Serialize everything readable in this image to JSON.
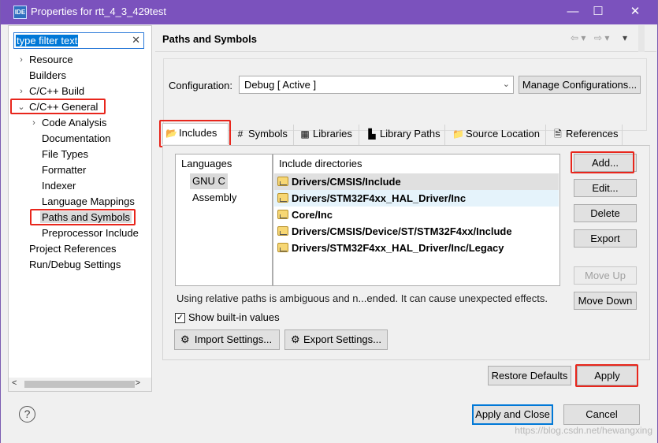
{
  "window": {
    "app_badge": "IDE",
    "title": "Properties for rtt_4_3_429test",
    "minimize_glyph": "—",
    "maximize_glyph": "☐",
    "close_glyph": "✕"
  },
  "left": {
    "filter_text": "type filter text",
    "filter_clear_glyph": "✕",
    "tree": [
      {
        "label": "Resource",
        "arrow": "›"
      },
      {
        "label": "Builders"
      },
      {
        "label": "C/C++ Build",
        "arrow": "›"
      },
      {
        "label": "C/C++ General",
        "arrow": "⌄"
      },
      {
        "label": "Code Analysis",
        "arrow": "›"
      },
      {
        "label": "Documentation"
      },
      {
        "label": "File Types"
      },
      {
        "label": "Formatter"
      },
      {
        "label": "Indexer"
      },
      {
        "label": "Language Mappings"
      },
      {
        "label": "Paths and Symbols"
      },
      {
        "label": "Preprocessor Include"
      },
      {
        "label": "Project References"
      },
      {
        "label": "Run/Debug Settings"
      }
    ],
    "scroll_left": "<",
    "scroll_right": ">"
  },
  "header": {
    "title": "Paths and Symbols",
    "nav_back": "⇦ ▾",
    "nav_forward": "⇨ ▾",
    "menu": "▾"
  },
  "config": {
    "label": "Configuration:",
    "value": "Debug  [ Active ]",
    "manage_button": "Manage Configurations..."
  },
  "tabs": [
    {
      "label": "Includes",
      "icon": "includes-icon",
      "glyph": "📂"
    },
    {
      "label": "Symbols",
      "icon": "hash-icon",
      "glyph": "#"
    },
    {
      "label": "Libraries",
      "icon": "libraries-icon",
      "glyph": "▦"
    },
    {
      "label": "Library Paths",
      "icon": "library-paths-icon",
      "glyph": "▙"
    },
    {
      "label": "Source Location",
      "icon": "source-location-icon",
      "glyph": "📁"
    },
    {
      "label": "References",
      "icon": "references-icon",
      "glyph": "🗎"
    }
  ],
  "languages": {
    "header": "Languages",
    "items": [
      "GNU C",
      "Assembly"
    ]
  },
  "includes": {
    "header": "Include directories",
    "items": [
      "Drivers/CMSIS/Include",
      "Drivers/STM32F4xx_HAL_Driver/Inc",
      "Core/Inc",
      "Drivers/CMSIS/Device/ST/STM32F4xx/Include",
      "Drivers/STM32F4xx_HAL_Driver/Inc/Legacy"
    ]
  },
  "side_buttons": {
    "add": "Add...",
    "edit": "Edit...",
    "delete": "Delete",
    "export": "Export",
    "move_up": "Move Up",
    "move_down": "Move Down"
  },
  "warning_text": "Using relative paths is ambiguous and n...ended. It can cause unexpected effects.",
  "show_builtin": {
    "label": "Show built-in values",
    "checked": true,
    "glyph": "✓"
  },
  "import_button": "Import Settings...",
  "export_settings_button": "Export Settings...",
  "restore_defaults": "Restore Defaults",
  "apply": "Apply",
  "apply_and_close": "Apply and Close",
  "cancel": "Cancel",
  "help_glyph": "?",
  "watermark": "https://blog.csdn.net/hewangxing",
  "colors": {
    "title_bar": "#7b52bd",
    "highlight_box": "#e8261c",
    "focus": "#0078d7"
  }
}
